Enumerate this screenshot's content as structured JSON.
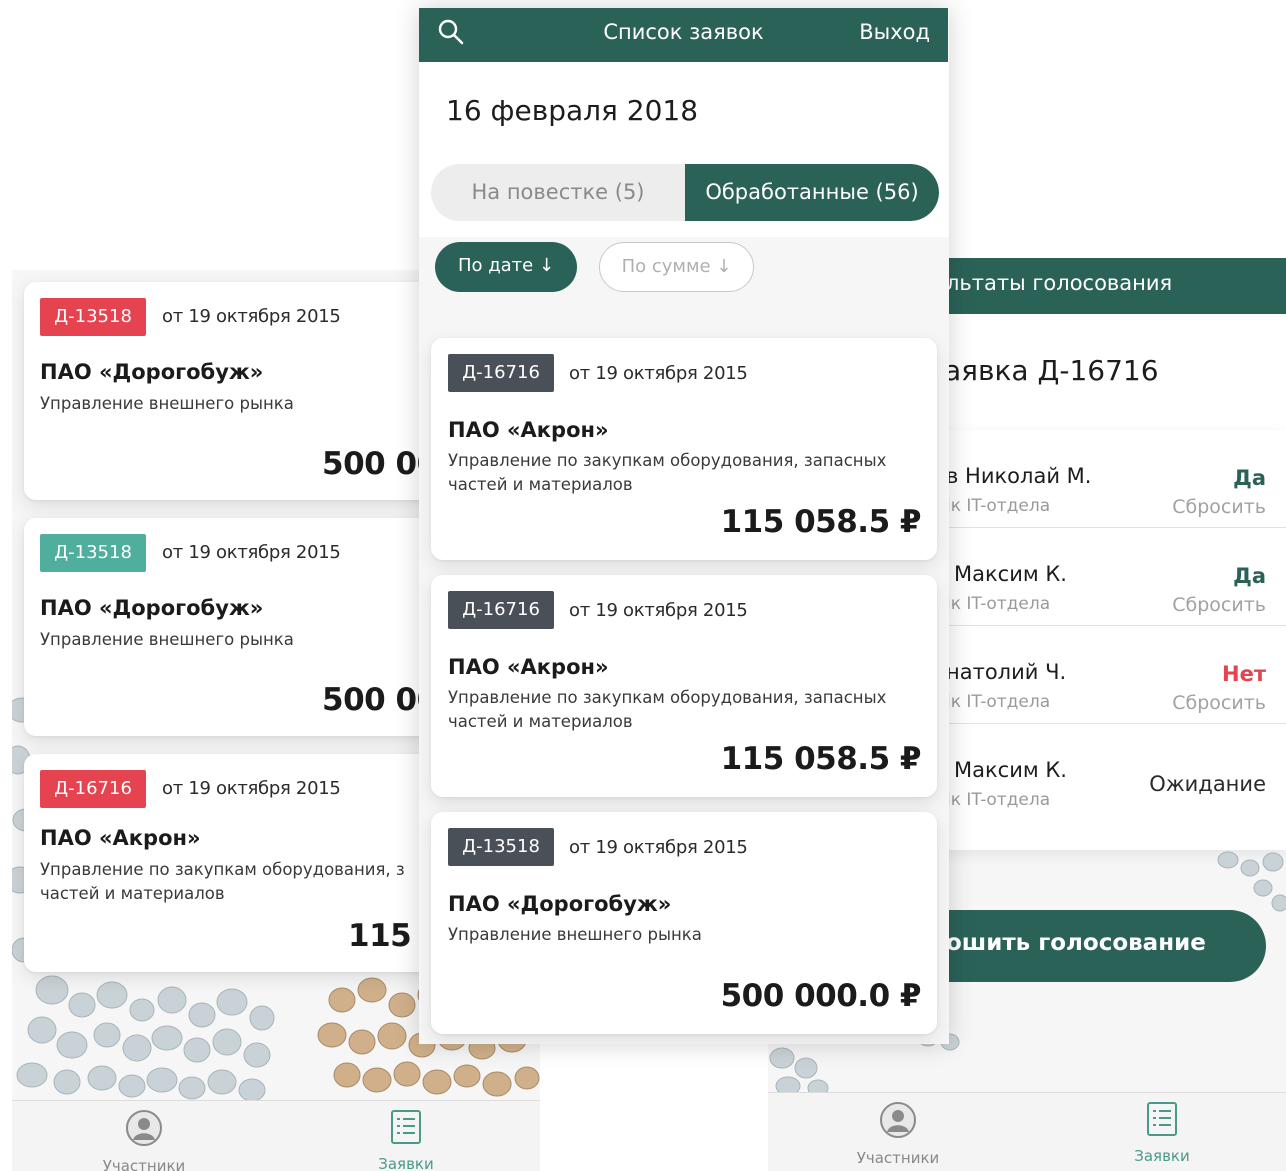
{
  "left_screen": {
    "cards": [
      {
        "badge": "Д-13518",
        "badge_color": "#e4434f",
        "date": "от 19 октября 2015",
        "company": "ПАО «Дорогобуж»",
        "dept_line1": "Управление внешнего рынка",
        "dept_line2": "",
        "amount": "500 00"
      },
      {
        "badge": "Д-13518",
        "badge_color": "#4fae9c",
        "date": "от 19 октября 2015",
        "company": "ПАО «Дорогобуж»",
        "dept_line1": "Управление внешнего рынка",
        "dept_line2": "",
        "amount": "500 00"
      },
      {
        "badge": "Д-16716",
        "badge_color": "#e4434f",
        "date": "от 19 октября 2015",
        "company": "ПАО «Акрон»",
        "dept_line1": "Управление по закупкам оборудования, з",
        "dept_line2": "частей и материалов",
        "amount": "115 0"
      }
    ],
    "tabbar": {
      "participants": "Участники",
      "requests": "Заявки"
    }
  },
  "center_screen": {
    "header": {
      "title": "Список заявок",
      "exit": "Выход",
      "search_icon": "search-icon"
    },
    "date_heading": "16 февраля 2018",
    "segments": {
      "agenda": "На повестке (5)",
      "processed": "Обработанные (56)",
      "active": "processed"
    },
    "sort": {
      "by_date": "По дате ↓",
      "by_sum": "По сумме ↓",
      "active": "by_date"
    },
    "cards": [
      {
        "badge": "Д-16716",
        "date": "от 19 октября 2015",
        "company": "ПАО «Акрон»",
        "dept_line1": "Управление по закупкам оборудования, запасных",
        "dept_line2": "частей и материалов",
        "amount": "115 058.5 ₽"
      },
      {
        "badge": "Д-16716",
        "date": "от 19 октября 2015",
        "company": "ПАО «Акрон»",
        "dept_line1": "Управление по закупкам оборудования, запасных",
        "dept_line2": "частей и материалов",
        "amount": "115 058.5 ₽"
      },
      {
        "badge": "Д-13518",
        "date": "от 19 октября 2015",
        "company": "ПАО «Дорогобуж»",
        "dept_line1": "Управление внешнего рынка",
        "dept_line2": "",
        "amount": "500 000.0 ₽"
      }
    ],
    "accent": "#2b6258",
    "badge_color": "#4a5058"
  },
  "right_screen": {
    "header_title": "льтаты голосования",
    "request_title": "аявка Д-16716",
    "votes": [
      {
        "name": "в Николай М.",
        "role": "ік IT-отдела",
        "answer": "Да",
        "answer_color": "#2b6258",
        "reset": "Сбросить"
      },
      {
        "name": "Максим К.",
        "role": "ік IT-отдела",
        "answer": "Да",
        "answer_color": "#2b6258",
        "reset": "Сбросить"
      },
      {
        "name": "натолий Ч.",
        "role": "ік IT-отдела",
        "answer": "Нет",
        "answer_color": "#e4434f",
        "reset": "Сбросить"
      },
      {
        "name": "Максим К.",
        "role": "ік IT-отдела",
        "answer": "",
        "answer_color": "#1d1d1d",
        "reset": ""
      }
    ],
    "pending_label": "Ожидание",
    "finish_button": "ошить голосование",
    "tabbar": {
      "participants": "Участники",
      "requests": "Заявки"
    }
  }
}
